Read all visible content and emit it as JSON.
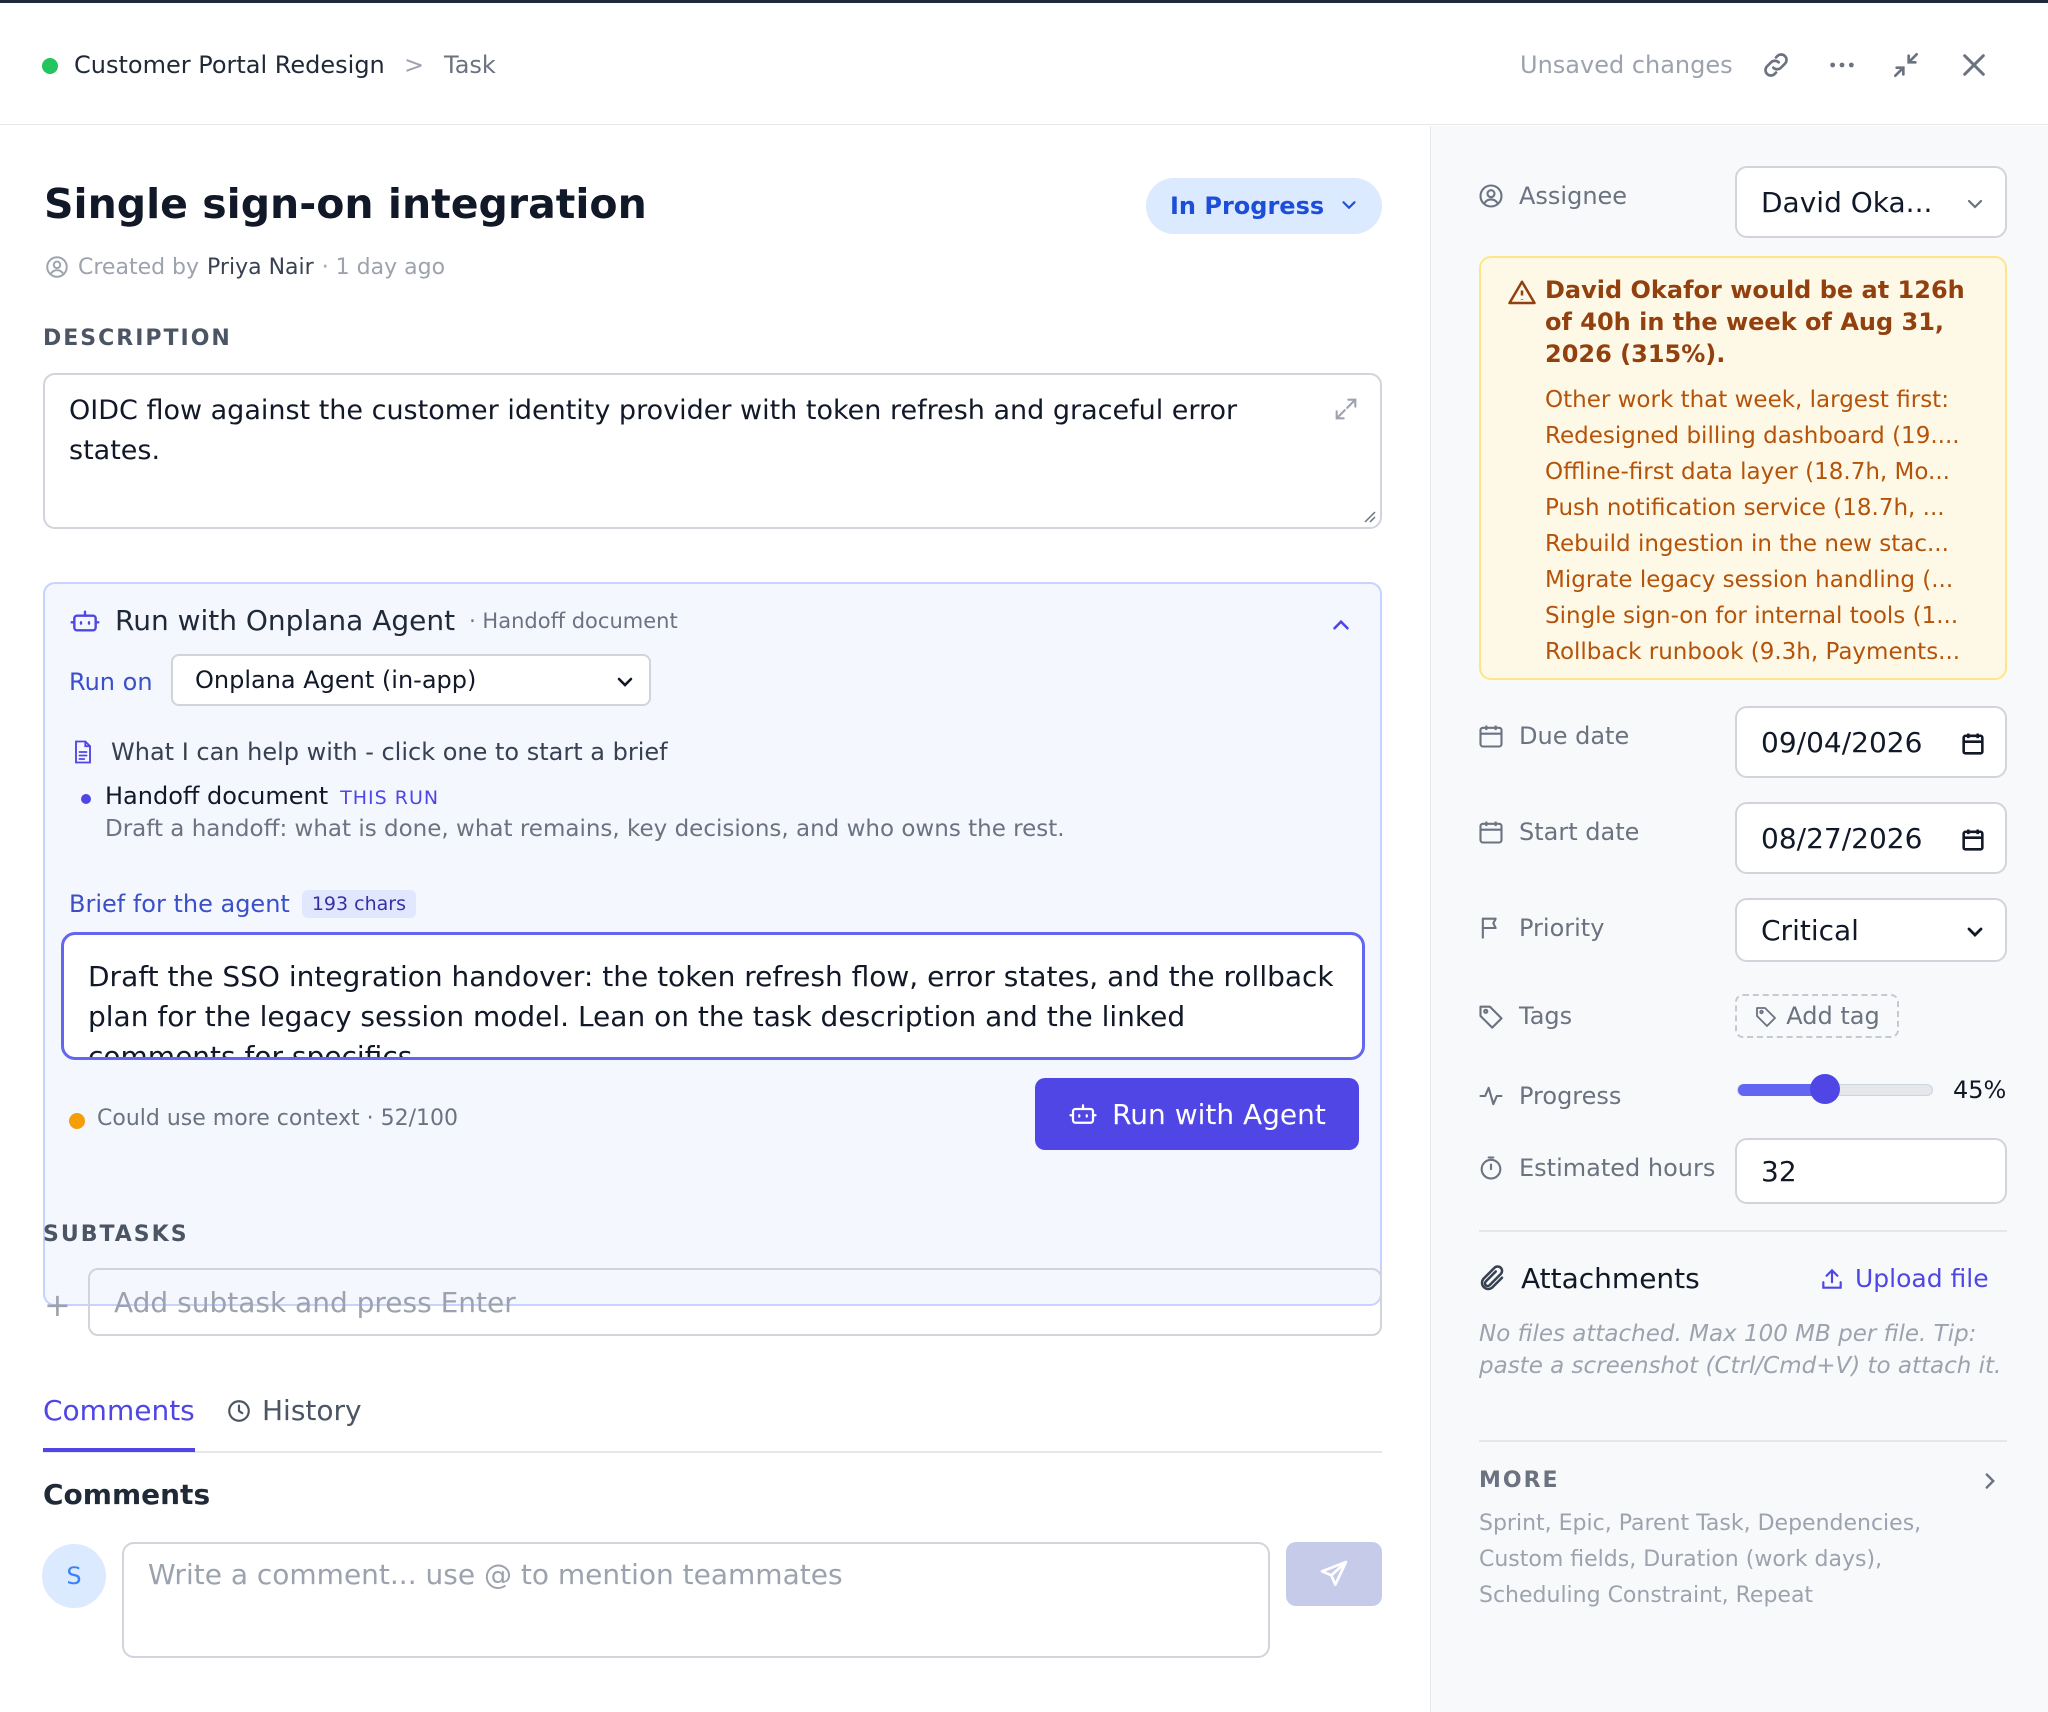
{
  "breadcrumb": {
    "project": "Customer Portal Redesign",
    "separator": ">",
    "current": "Task"
  },
  "header": {
    "unsaved": "Unsaved changes"
  },
  "task": {
    "title": "Single sign-on integration",
    "status": "In Progress",
    "created_prefix": "Created by",
    "created_by": "Priya Nair",
    "created_ago": "· 1 day ago"
  },
  "description": {
    "label": "DESCRIPTION",
    "text": "OIDC flow against the customer identity provider with token refresh and graceful error states."
  },
  "agent": {
    "title": "Run with Onplana Agent",
    "subtitle": "· Handoff document",
    "run_on_label": "Run on",
    "run_on_value": "Onplana Agent (in-app)",
    "help_text": "What I can help with - click one to start a brief",
    "option_title": "Handoff document",
    "option_badge": "THIS RUN",
    "option_desc": "Draft a handoff: what is done, what remains, key decisions, and who owns the rest.",
    "brief_label": "Brief for the agent",
    "brief_chars": "193 chars",
    "brief_text": "Draft the SSO integration handover: the token refresh flow, error states, and the rollback plan for the legacy session model. Lean on the task description and the linked comments for specifics.",
    "context_text": "Could use more context · 52/100",
    "run_button": "Run with Agent"
  },
  "subtasks": {
    "label": "SUBTASKS",
    "placeholder": "Add subtask and press Enter"
  },
  "tabs": {
    "comments": "Comments",
    "history": "History"
  },
  "comments": {
    "heading": "Comments",
    "avatar_initial": "S",
    "placeholder": "Write a comment... use @ to mention teammates"
  },
  "side": {
    "assignee_label": "Assignee",
    "assignee_value": "David Oka...",
    "warning_title": "David Okafor would be at 126h of 40h in the week of Aug 31, 2026 (315%).",
    "warning_items": [
      "Other work that week, largest first:",
      "Redesigned billing dashboard (19....",
      "Offline-first data layer (18.7h, Mo...",
      "Push notification service (18.7h, ...",
      "Rebuild ingestion in the new stac...",
      "Migrate legacy session handling (...",
      "Single sign-on for internal tools (1...",
      "Rollback runbook (9.3h, Payments..."
    ],
    "due_label": "Due date",
    "due_value": "09/04/2026",
    "start_label": "Start date",
    "start_value": "08/27/2026",
    "priority_label": "Priority",
    "priority_value": "Critical",
    "tags_label": "Tags",
    "tags_add": "Add tag",
    "progress_label": "Progress",
    "progress_value": "45%",
    "progress_fraction": 0.45,
    "hours_label": "Estimated hours",
    "hours_value": "32",
    "attachments_label": "Attachments",
    "upload_label": "Upload file",
    "attachments_note": "No files attached. Max 100 MB per file. Tip: paste a screenshot (Ctrl/Cmd+V) to attach it.",
    "more_label": "MORE",
    "more_text": "Sprint, Epic, Parent Task, Dependencies, Custom fields, Duration (work days), Scheduling Constraint, Repeat"
  },
  "colors": {
    "accent": "#4f46e5",
    "status_pill_bg": "#dbeafe",
    "warning_bg": "#fef9e7",
    "warning_text": "#92400e"
  }
}
